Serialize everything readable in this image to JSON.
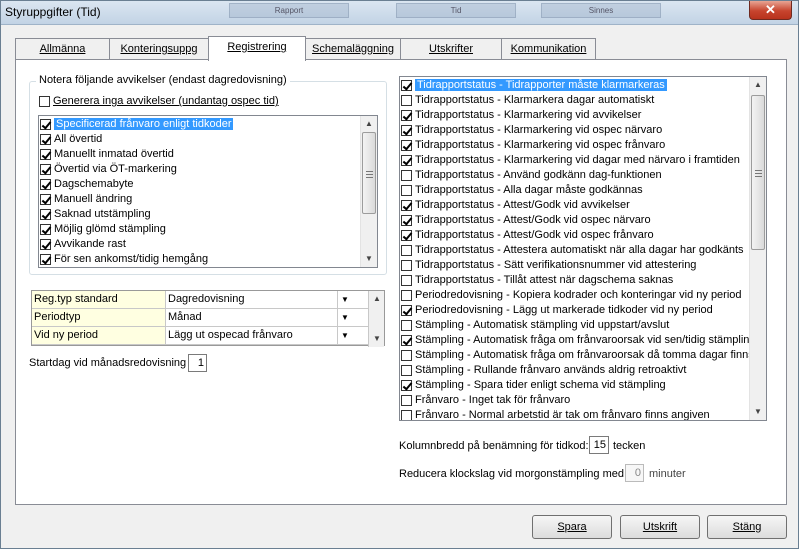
{
  "window": {
    "title": "Styruppgifter (Tid)",
    "close_label": "✕"
  },
  "background_tabs": [
    "Rapport",
    "Tid",
    "Sinnes"
  ],
  "tabs": [
    {
      "label": "Allmänna"
    },
    {
      "label": "Konteringsuppg"
    },
    {
      "label": "Registrering"
    },
    {
      "label": "Schemaläggning"
    },
    {
      "label": "Utskrifter"
    },
    {
      "label": "Kommunikation"
    }
  ],
  "left": {
    "group_title": "Notera följande avvikelser (endast dagredovisning)",
    "no_deviations_label": "Generera inga avvikelser (undantag ospec tid)",
    "no_deviations_checked": false,
    "deviations": [
      {
        "label": "Specificerad frånvaro enligt tidkoder",
        "checked": true,
        "selected": true
      },
      {
        "label": "All övertid",
        "checked": true
      },
      {
        "label": "Manuellt inmatad övertid",
        "checked": true
      },
      {
        "label": "Övertid via ÖT-markering",
        "checked": true
      },
      {
        "label": "Dagschemabyte",
        "checked": true
      },
      {
        "label": "Manuell ändring",
        "checked": true
      },
      {
        "label": "Saknad utstämpling",
        "checked": true
      },
      {
        "label": "Möjlig glömd stämpling",
        "checked": true
      },
      {
        "label": "Avvikande rast",
        "checked": true
      },
      {
        "label": "För sen ankomst/tidig hemgång",
        "checked": true
      }
    ],
    "grid": [
      {
        "label": "Reg.typ standard",
        "value": "Dagredovisning"
      },
      {
        "label": "Periodtyp",
        "value": "Månad"
      },
      {
        "label": "Vid ny period",
        "value": "Lägg ut ospecad frånvaro"
      }
    ],
    "startdag_label": "Startdag vid månadsredovisning",
    "startdag_value": "1"
  },
  "right": {
    "options": [
      {
        "label": "Tidrapportstatus - Tidrapporter måste klarmarkeras",
        "checked": true,
        "selected": true
      },
      {
        "label": "Tidrapportstatus - Klarmarkera dagar automatiskt",
        "checked": false
      },
      {
        "label": "Tidrapportstatus - Klarmarkering vid avvikelser",
        "checked": true
      },
      {
        "label": "Tidrapportstatus - Klarmarkering vid ospec närvaro",
        "checked": true
      },
      {
        "label": "Tidrapportstatus - Klarmarkering vid ospec frånvaro",
        "checked": true
      },
      {
        "label": "Tidrapportstatus - Klarmarkering vid dagar med närvaro i framtiden",
        "checked": true
      },
      {
        "label": "Tidrapportstatus - Använd godkänn dag-funktionen",
        "checked": false
      },
      {
        "label": "Tidrapportstatus - Alla dagar måste godkännas",
        "checked": false
      },
      {
        "label": "Tidrapportstatus - Attest/Godk vid avvikelser",
        "checked": true
      },
      {
        "label": "Tidrapportstatus - Attest/Godk vid ospec närvaro",
        "checked": true
      },
      {
        "label": "Tidrapportstatus - Attest/Godk vid ospec frånvaro",
        "checked": true
      },
      {
        "label": "Tidrapportstatus - Attestera automatiskt när alla dagar har godkänts",
        "checked": false
      },
      {
        "label": "Tidrapportstatus - Sätt verifikationsnummer vid attestering",
        "checked": false
      },
      {
        "label": "Tidrapportstatus - Tillåt attest när dagschema saknas",
        "checked": false
      },
      {
        "label": "Periodredovisning - Kopiera kodrader och konteringar vid ny period",
        "checked": false
      },
      {
        "label": "Periodredovisning - Lägg ut markerade tidkoder vid ny period",
        "checked": true
      },
      {
        "label": "Stämpling - Automatisk stämpling vid uppstart/avslut",
        "checked": false
      },
      {
        "label": "Stämpling - Automatisk fråga om frånvaroorsak vid sen/tidig stämpling",
        "checked": true
      },
      {
        "label": "Stämpling - Automatisk fråga om frånvaroorsak då tomma dagar finns",
        "checked": false
      },
      {
        "label": "Stämpling - Rullande frånvaro används aldrig retroaktivt",
        "checked": false
      },
      {
        "label": "Stämpling - Spara tider enligt schema vid stämpling",
        "checked": true
      },
      {
        "label": "Frånvaro - Inget tak för frånvaro",
        "checked": false
      },
      {
        "label": "Frånvaro - Normal arbetstid är tak om frånvaro finns angiven",
        "checked": false
      }
    ],
    "column_width_label": "Kolumnbredd på benämning för tidkod:",
    "column_width_value": "15",
    "column_width_unit": "tecken",
    "reduce_label": "Reducera klockslag vid morgonstämpling med",
    "reduce_value": "0",
    "reduce_unit": "minuter"
  },
  "buttons": {
    "save": "Spara",
    "print": "Utskrift",
    "close": "Stäng"
  }
}
